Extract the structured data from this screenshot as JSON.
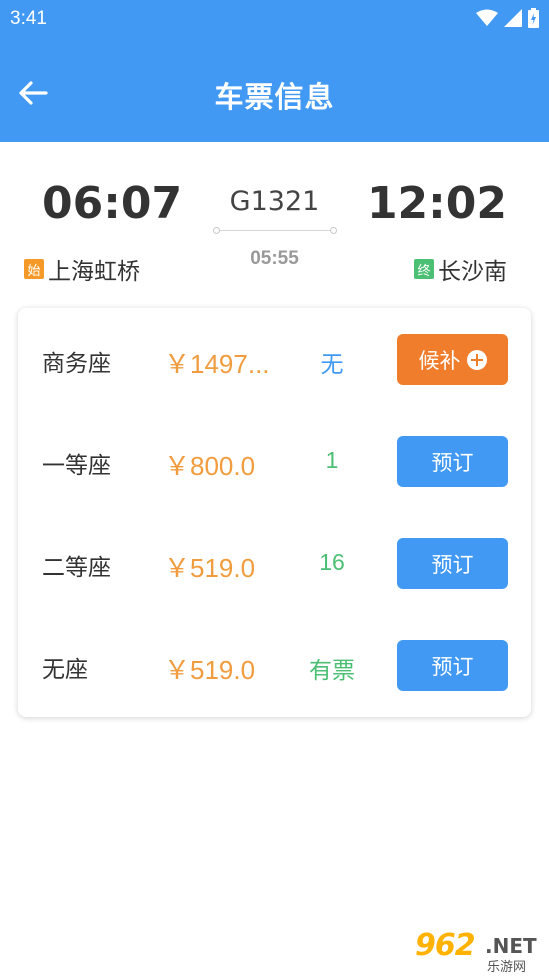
{
  "status_bar": {
    "time": "3:41"
  },
  "header": {
    "title": "车票信息"
  },
  "train": {
    "departure_time": "06:07",
    "arrival_time": "12:02",
    "number": "G1321",
    "duration": "05:55",
    "departure_tag": "始",
    "departure_station": "上海虹桥",
    "arrival_tag": "终",
    "arrival_station": "长沙南"
  },
  "seats": [
    {
      "name": "商务座",
      "price": "￥1497...",
      "stock": "无",
      "stock_color": "#4199f3",
      "button": "候补",
      "button_type": "wait"
    },
    {
      "name": "一等座",
      "price": "￥800.0",
      "stock": "1",
      "stock_color": "#4bbf73",
      "button": "预订",
      "button_type": "book"
    },
    {
      "name": "二等座",
      "price": "￥519.0",
      "stock": "16",
      "stock_color": "#4bbf73",
      "button": "预订",
      "button_type": "book"
    },
    {
      "name": "无座",
      "price": "￥519.0",
      "stock": "有票",
      "stock_color": "#4bbf73",
      "button": "预订",
      "button_type": "book"
    }
  ],
  "colors": {
    "primary": "#4199f3",
    "price": "#f19c3e",
    "waitlist": "#f07d2b",
    "available": "#4bbf73"
  },
  "watermark": {
    "number": "962",
    "suffix": ".NET",
    "text": "乐游网"
  }
}
